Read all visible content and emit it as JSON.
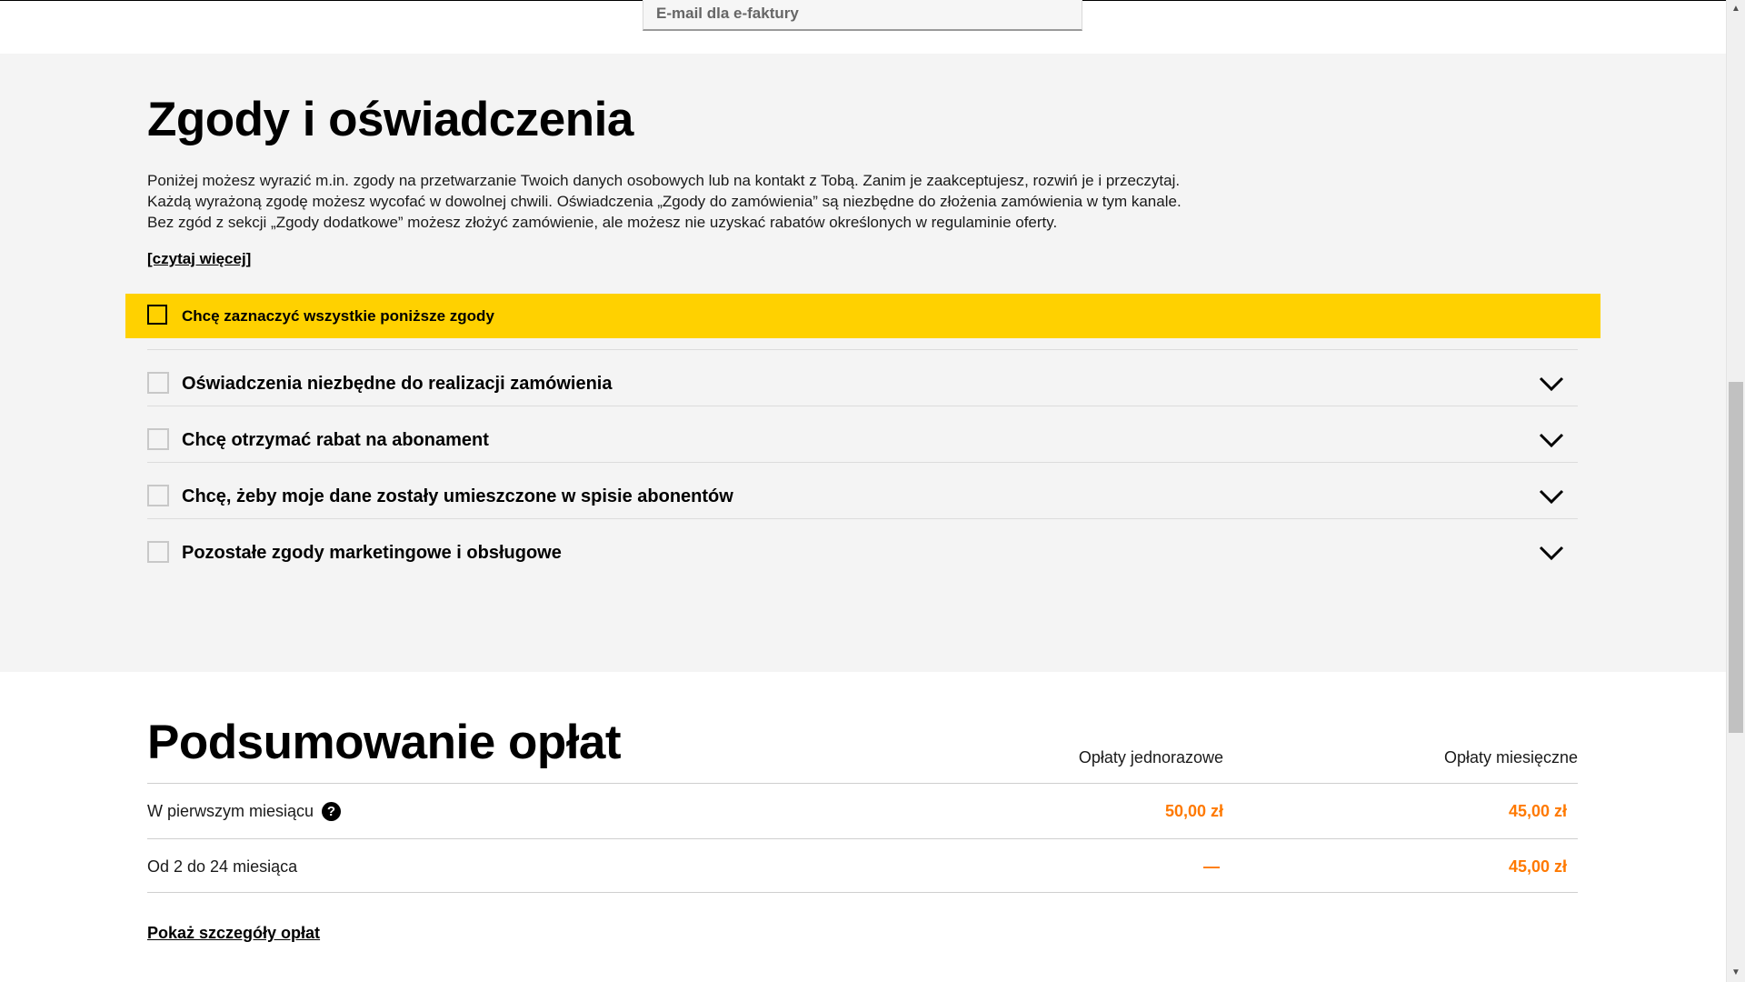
{
  "email": {
    "placeholder": "E-mail dla e-faktury"
  },
  "consents": {
    "title": "Zgody i oświadczenia",
    "description": [
      "Poniżej możesz wyrazić m.in. zgody na przetwarzanie Twoich danych osobowych lub na kontakt z Tobą. Zanim je zaakceptujesz, rozwiń je i przeczytaj.",
      "Każdą wyrażoną zgodę możesz wycofać w dowolnej chwili. Oświadczenia „Zgody do zamówienia” są niezbędne do złożenia zamówienia w tym kanale.",
      "Bez zgód z sekcji „Zgody dodatkowe” możesz złożyć zamówienie, ale możesz nie uzyskać rabatów określonych w regulaminie oferty."
    ],
    "read_more": "[czytaj więcej]",
    "select_all_label": "Chcę zaznaczyć wszystkie poniższe zgody",
    "items": [
      {
        "label": "Oświadczenia niezbędne do realizacji zamówienia"
      },
      {
        "label": "Chcę otrzymać rabat na abonament"
      },
      {
        "label": "Chcę, żeby moje dane zostały umieszczone w spisie abonentów"
      },
      {
        "label": "Pozostałe zgody marketingowe i obsługowe"
      }
    ]
  },
  "summary": {
    "title": "Podsumowanie opłat",
    "columns": {
      "one_time": "Opłaty jednorazowe",
      "monthly": "Opłaty miesięczne"
    },
    "rows": [
      {
        "name": "W pierwszym miesiącu",
        "one_time": "50,00 zł",
        "monthly": "45,00 zł",
        "help": "?"
      },
      {
        "name": "Od 2 do 24 miesiąca",
        "one_time": "—",
        "monthly": "45,00 zł"
      }
    ],
    "show_details": "Pokaż szczegóły opłat"
  },
  "colors": {
    "accent_yellow": "#ffd100",
    "price_orange": "#ff7900",
    "section_bg": "#f4f4f4"
  },
  "icons": {
    "chevron": "chevron-down-icon",
    "help": "help-icon",
    "scroll_up": "scroll-up-arrow-icon",
    "scroll_down": "scroll-down-arrow-icon"
  }
}
